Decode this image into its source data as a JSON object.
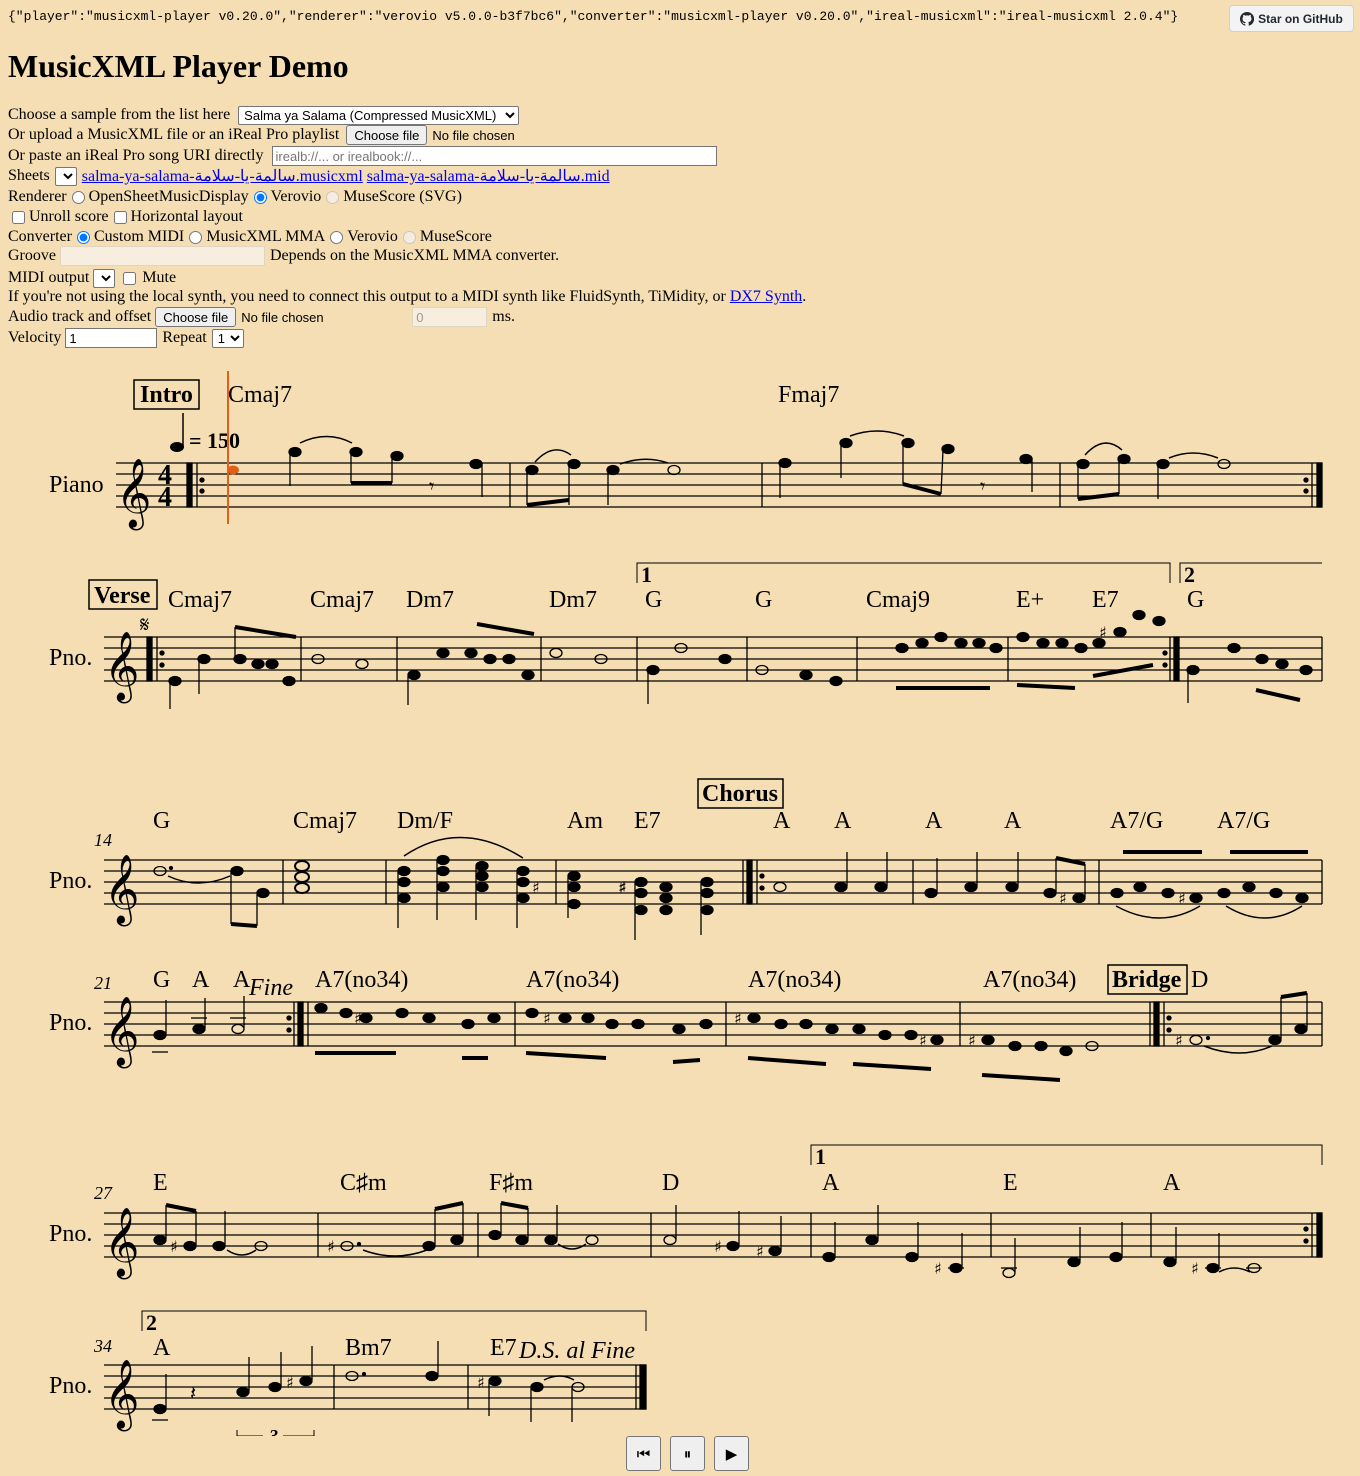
{
  "version_json": "{\"player\":\"musicxml-player v0.20.0\",\"renderer\":\"verovio v5.0.0-b3f7bc6\",\"converter\":\"musicxml-player v0.20.0\",\"ireal-musicxml\":\"ireal-musicxml 2.0.4\"}",
  "github_label": "Star on GitHub",
  "title": "MusicXML Player Demo",
  "sample": {
    "label": "Choose a sample from the list here",
    "selected": "Salma ya Salama (Compressed MusicXML)"
  },
  "upload": {
    "label": "Or upload a MusicXML file or an iReal Pro playlist",
    "button": "Choose file",
    "status": "No file chosen"
  },
  "paste": {
    "label": "Or paste an iReal Pro song URI directly",
    "placeholder": "irealb://... or irealbook://..."
  },
  "sheets": {
    "label": "Sheets",
    "link_musicxml": "salma-ya-salama-سالمة-يا-سلامة.musicxml",
    "link_mid": "salma-ya-salama-سالمة-يا-سلامة.mid"
  },
  "renderer": {
    "label": "Renderer",
    "options": [
      "OpenSheetMusicDisplay",
      "Verovio",
      "MuseScore (SVG)"
    ],
    "selected": "Verovio"
  },
  "layout": {
    "unroll": "Unroll score",
    "horizontal": "Horizontal layout"
  },
  "converter": {
    "label": "Converter",
    "options": [
      "Custom MIDI",
      "MusicXML MMA",
      "Verovio",
      "MuseScore"
    ],
    "selected": "Custom MIDI"
  },
  "groove": {
    "label": "Groove",
    "note": "Depends on the MusicXML MMA converter."
  },
  "midi": {
    "label": "MIDI output",
    "mute": "Mute"
  },
  "midi_note": {
    "text": "If you're not using the local synth, you need to connect this output to a MIDI synth like FluidSynth, TiMidity, or",
    "link": "DX7 Synth",
    "end": "."
  },
  "audio": {
    "label": "Audio track and offset",
    "button": "Choose file",
    "status": "No file chosen",
    "offset": "0",
    "unit": "ms."
  },
  "velocity": {
    "label": "Velocity",
    "value": "1"
  },
  "repeat": {
    "label": "Repeat",
    "value": "1"
  },
  "score": {
    "tempo": "= 150",
    "instrument": "Piano",
    "instrument_short": "Pno.",
    "sections": [
      "Intro",
      "Verse",
      "Chorus",
      "Bridge"
    ],
    "chords_sys1": [
      "Cmaj7",
      "Fmaj7"
    ],
    "chords_sys2": [
      "Cmaj7",
      "Cmaj7",
      "Dm7",
      "Dm7",
      "G",
      "G",
      "Cmaj9",
      "E+",
      "E7",
      "G"
    ],
    "chords_sys3": [
      "G",
      "Cmaj7",
      "Dm/F",
      "Am",
      "E7",
      "A",
      "A",
      "A",
      "A",
      "A7/G",
      "A7/G"
    ],
    "chords_sys4": [
      "G",
      "A",
      "A",
      "A7(no34)",
      "A7(no34)",
      "A7(no34)",
      "A7(no34)",
      "D"
    ],
    "chords_sys5": [
      "E",
      "C♯m",
      "F♯m",
      "D",
      "A",
      "E",
      "A"
    ],
    "chords_sys6": [
      "A",
      "Bm7",
      "E7"
    ],
    "measure_numbers": [
      "14",
      "21",
      "27",
      "34"
    ],
    "endings": [
      "1",
      "2",
      "1",
      "2"
    ],
    "fine": "Fine",
    "ds": "D.S. al Fine",
    "triplet": "3"
  },
  "controls": {
    "rewind": "⏮",
    "pause": "⏸",
    "play": "▶"
  }
}
